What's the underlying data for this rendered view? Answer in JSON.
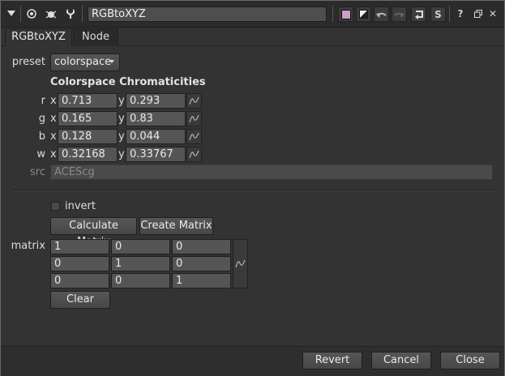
{
  "titlebar": {
    "node_name": "RGBtoXYZ",
    "icons": [
      "collapse-arrow-icon",
      "center-node-icon",
      "bug-icon",
      "wrench-icon",
      "color-swatch-icon",
      "gray-swatch-icon",
      "undo-icon",
      "redo-icon",
      "revert-knobs-icon",
      "s-icon",
      "help-icon",
      "float-icon",
      "close-icon"
    ],
    "s_label": "S",
    "help_label": "?",
    "float_label": "🗗",
    "close_label": "✕"
  },
  "tabs": [
    {
      "label": "RGBtoXYZ",
      "active": true
    },
    {
      "label": "Node",
      "active": false
    }
  ],
  "preset": {
    "label": "preset",
    "value": "colorspace"
  },
  "chromaticities": {
    "title": "Colorspace Chromaticities",
    "rows": [
      {
        "name": "r",
        "x": "0.713",
        "y": "0.293"
      },
      {
        "name": "g",
        "x": "0.165",
        "y": "0.83"
      },
      {
        "name": "b",
        "x": "0.128",
        "y": "0.044"
      },
      {
        "name": "w",
        "x": "0.32168",
        "y": "0.33767"
      }
    ],
    "x_label": "x",
    "y_label": "y"
  },
  "src": {
    "label": "src",
    "value": "ACEScg"
  },
  "invert": {
    "label": "invert",
    "checked": false
  },
  "buttons": {
    "calculate": "Calculate Matrix",
    "create": "Create Matrix",
    "clear": "Clear"
  },
  "matrix": {
    "label": "matrix",
    "rows": [
      [
        "1",
        "0",
        "0"
      ],
      [
        "0",
        "1",
        "0"
      ],
      [
        "0",
        "0",
        "1"
      ]
    ]
  },
  "footer": {
    "revert": "Revert",
    "cancel": "Cancel",
    "close": "Close"
  },
  "colors": {
    "accent_swatch": "#c8a0c8",
    "background": "#333333",
    "field": "#555555"
  }
}
